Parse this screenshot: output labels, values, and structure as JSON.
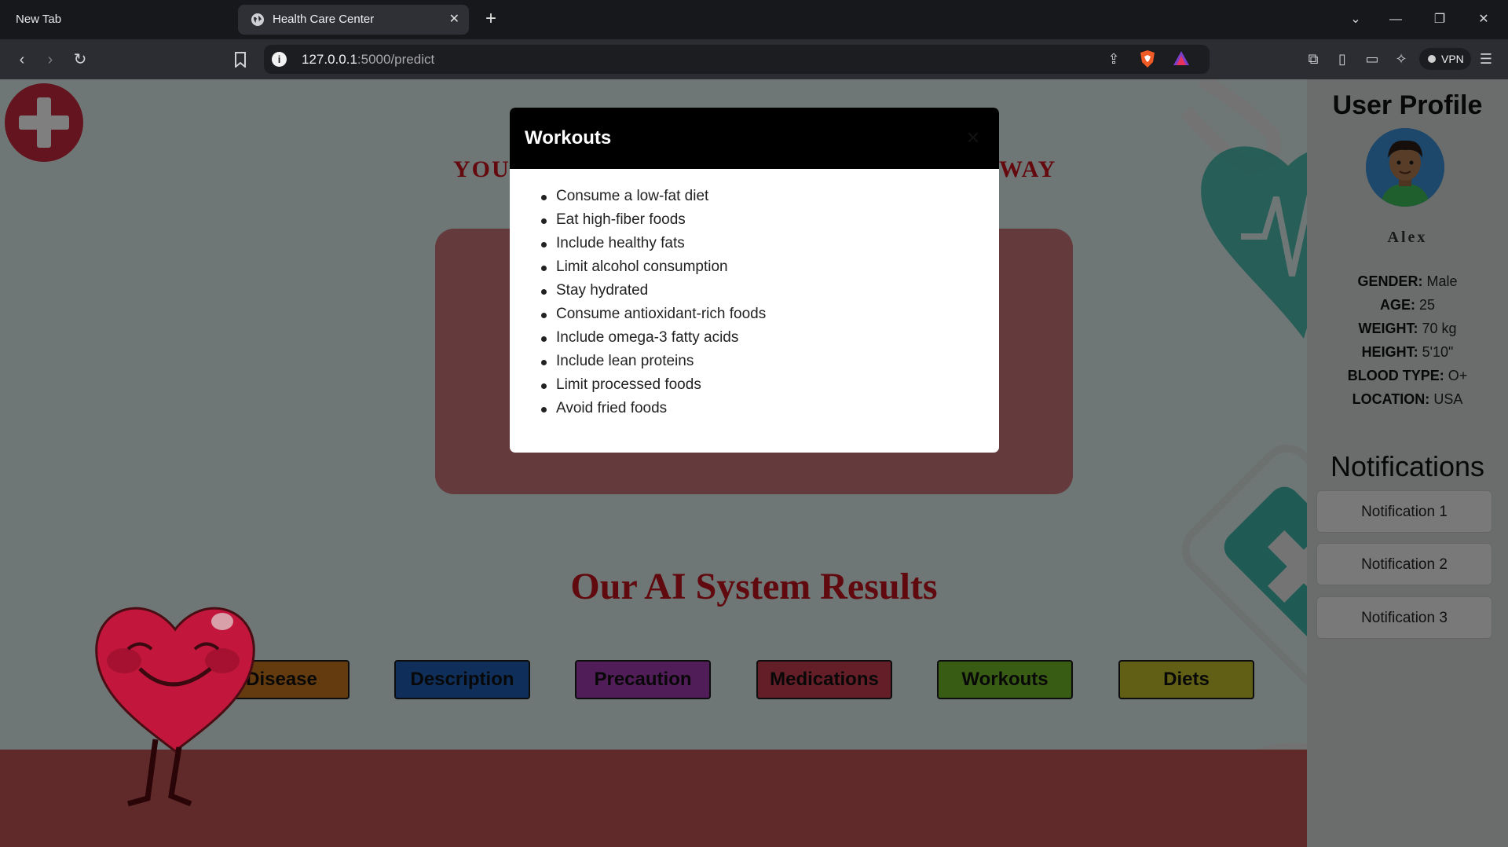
{
  "browser": {
    "tabs": [
      {
        "title": "New Tab",
        "active": false
      },
      {
        "title": "Health Care Center",
        "active": true
      }
    ],
    "url_host": "127.0.0.1",
    "url_rest": ":5000/predict",
    "vpn_label": "VPN"
  },
  "page": {
    "tagline_left": "YOU",
    "tagline_right": "WAY",
    "results_title": "Our AI System Results",
    "result_buttons": [
      {
        "label": "Disease",
        "color": "#c8761e"
      },
      {
        "label": "Description",
        "color": "#1e5fb4"
      },
      {
        "label": "Precaution",
        "color": "#a23bb0"
      },
      {
        "label": "Medications",
        "color": "#c93d4e"
      },
      {
        "label": "Workouts",
        "color": "#73b82a"
      },
      {
        "label": "Diets",
        "color": "#c2be2b"
      }
    ]
  },
  "sidebar": {
    "title": "User Profile",
    "username": "Alex",
    "profile": [
      {
        "label": "GENDER:",
        "value": "Male"
      },
      {
        "label": "AGE:",
        "value": "25"
      },
      {
        "label": "WEIGHT:",
        "value": "70 kg"
      },
      {
        "label": "HEIGHT:",
        "value": "5'10\""
      },
      {
        "label": "BLOOD TYPE:",
        "value": "O+"
      },
      {
        "label": "LOCATION:",
        "value": "USA"
      }
    ],
    "notifications_title": "Notifications",
    "notifications": [
      "Notification 1",
      "Notification 2",
      "Notification 3"
    ]
  },
  "modal": {
    "title": "Workouts",
    "items": [
      "Consume a low-fat diet",
      "Eat high-fiber foods",
      "Include healthy fats",
      "Limit alcohol consumption",
      "Stay hydrated",
      "Consume antioxidant-rich foods",
      "Include omega-3 fatty acids",
      "Include lean proteins",
      "Limit processed foods",
      "Avoid fried foods"
    ]
  },
  "icons": {
    "logo": "medical-cross-icon",
    "avatar": "user-avatar-icon",
    "mascot": "heart-mascot-icon"
  },
  "colors": {
    "accent_red": "#c0121c",
    "modal_header": "#000000",
    "teal_decor": "#3fb6a8"
  }
}
